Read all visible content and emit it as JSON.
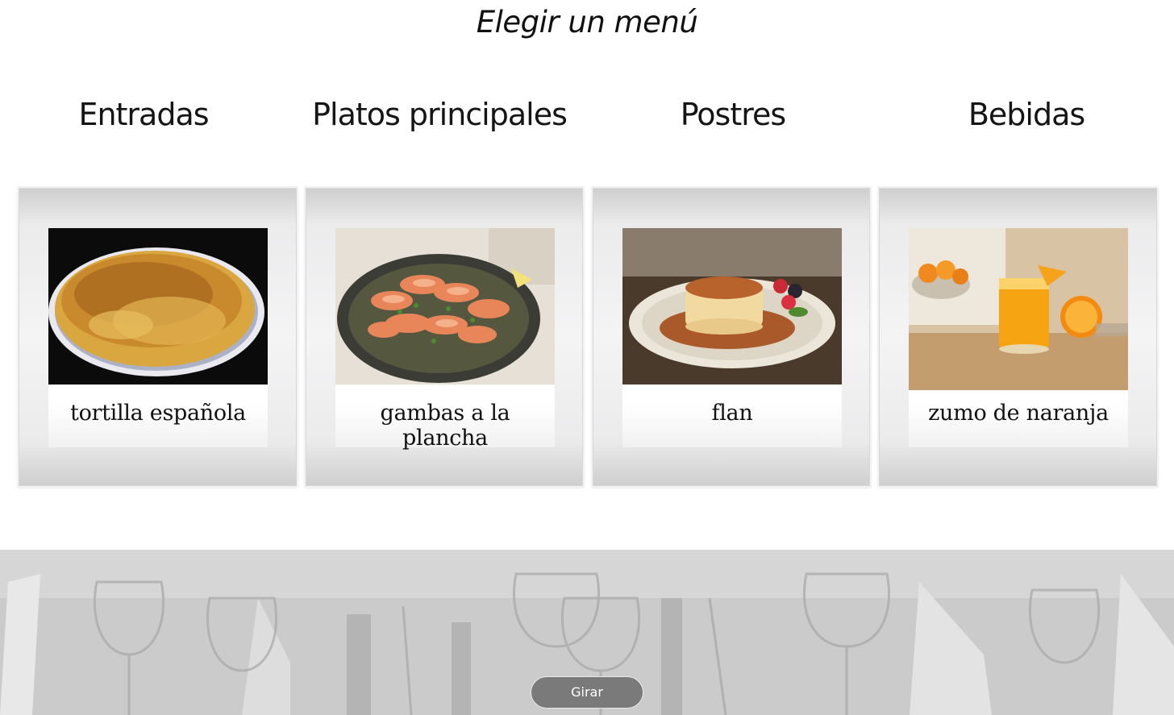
{
  "page": {
    "title": "Elegir un menú"
  },
  "categories": [
    {
      "label": "Entradas",
      "dish": "tortilla española",
      "image": "spanish-omelette-photo"
    },
    {
      "label": "Platos principales",
      "dish": "gambas a la plancha",
      "image": "grilled-prawns-photo"
    },
    {
      "label": "Postres",
      "dish": "flan",
      "image": "caramel-flan-photo"
    },
    {
      "label": "Bebidas",
      "dish": "zumo de naranja",
      "image": "orange-juice-photo"
    }
  ],
  "controls": {
    "spin_label": "Girar"
  },
  "colors": {
    "button_bg": "#7a7a7a",
    "band_bg": "#cfcfcf"
  }
}
